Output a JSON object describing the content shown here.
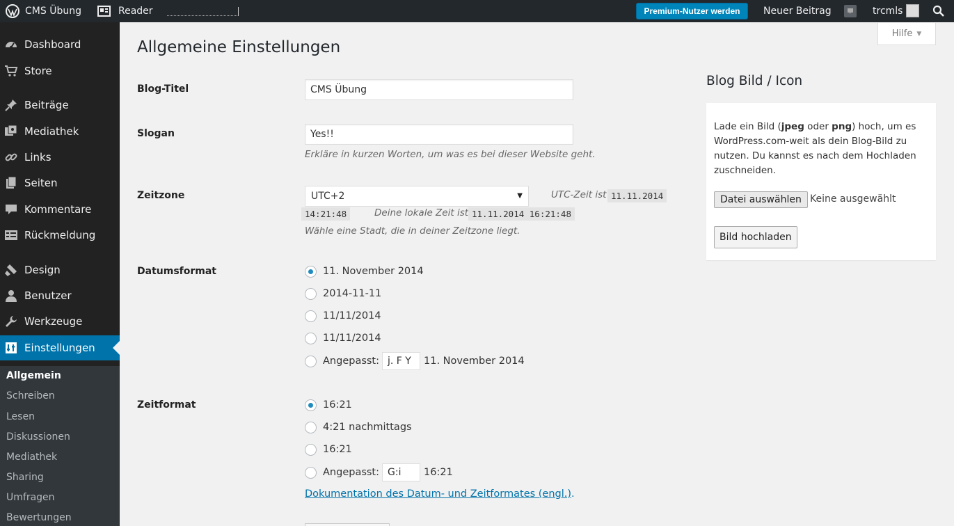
{
  "adminbar": {
    "site_name": "CMS Übung",
    "reader": "Reader",
    "premium_button": "Premium-Nutzer werden",
    "new_post": "Neuer Beitrag",
    "username": "trcmls"
  },
  "sidebar": {
    "items": [
      {
        "label": "Dashboard",
        "icon": "dashboard-icon"
      },
      {
        "label": "Store",
        "icon": "cart-icon"
      },
      {
        "label": "Beiträge",
        "icon": "pin-icon"
      },
      {
        "label": "Mediathek",
        "icon": "media-icon"
      },
      {
        "label": "Links",
        "icon": "link-icon"
      },
      {
        "label": "Seiten",
        "icon": "pages-icon"
      },
      {
        "label": "Kommentare",
        "icon": "comment-icon"
      },
      {
        "label": "Rückmeldung",
        "icon": "feedback-icon"
      },
      {
        "label": "Design",
        "icon": "brush-icon"
      },
      {
        "label": "Benutzer",
        "icon": "user-icon"
      },
      {
        "label": "Werkzeuge",
        "icon": "wrench-icon"
      },
      {
        "label": "Einstellungen",
        "icon": "settings-icon"
      }
    ],
    "submenu": [
      "Allgemein",
      "Schreiben",
      "Lesen",
      "Diskussionen",
      "Mediathek",
      "Sharing",
      "Umfragen",
      "Bewertungen"
    ]
  },
  "help_tab": "Hilfe",
  "page_title": "Allgemeine Einstellungen",
  "form": {
    "blog_title_label": "Blog-Titel",
    "blog_title_value": "CMS Übung",
    "slogan_label": "Slogan",
    "slogan_value": "Yes!!",
    "slogan_desc": "Erkläre in kurzen Worten, um was es bei dieser Website geht.",
    "timezone_label": "Zeitzone",
    "timezone_value": "UTC+2",
    "utc_label": "UTC-Zeit ist",
    "utc_date": "11.11.2014",
    "utc_time": "14:21:48",
    "local_label": "Deine lokale Zeit ist",
    "local_time": "11.11.2014 16:21:48",
    "timezone_desc": "Wähle eine Stadt, die in deiner Zeitzone liegt.",
    "date_format_label": "Datumsformat",
    "date_options": [
      "11. November 2014",
      "2014-11-11",
      "11/11/2014",
      "11/11/2014"
    ],
    "custom_label": "Angepasst:",
    "date_custom_value": "j. F Y",
    "date_custom_preview": "11. November 2014",
    "time_format_label": "Zeitformat",
    "time_options": [
      "16:21",
      "4:21 nachmittags",
      "16:21"
    ],
    "time_custom_value": "G:i",
    "time_custom_preview": "16:21",
    "doc_link": "Dokumentation des Datum- und Zeitformates (engl.)",
    "doc_link_suffix": "."
  },
  "blog_image": {
    "title": "Blog Bild / Icon",
    "desc_1": "Lade ein Bild (",
    "desc_jpeg": "jpeg",
    "desc_2": " oder ",
    "desc_png": "png",
    "desc_3": ") hoch, um es WordPress.com-weit als dein Blog-Bild zu nutzen. Du kannst es nach dem Hochladen zuschneiden.",
    "choose_file": "Datei auswählen",
    "no_file": "Keine ausgewählt",
    "upload_button": "Bild hochladen"
  },
  "colors": {
    "adminbar": "#23282d",
    "sidebar": "#222222",
    "accent": "#0073aa",
    "premium": "#0085ba"
  }
}
